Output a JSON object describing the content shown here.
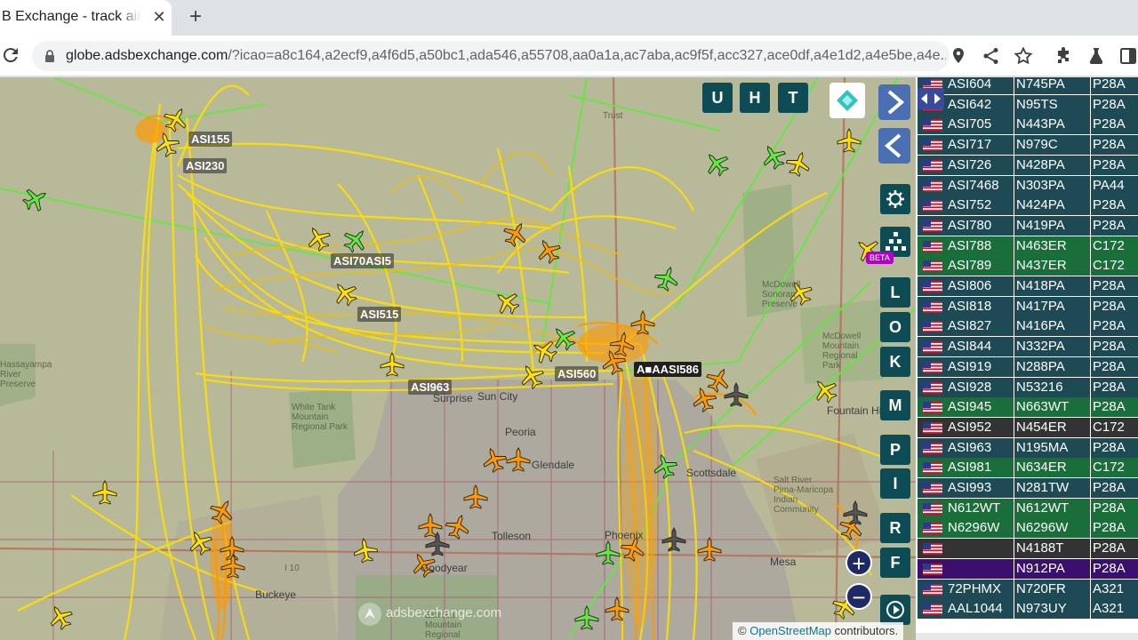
{
  "browser": {
    "tab_title": "B Exchange - track aircraft",
    "url_host": "globe.adsbexchange.com",
    "url_rest": "/?icao=a8c164,a2ecf9,a4f6d5,a50bc1,ada546,a55708,aa0a1a,ac7aba,ac9f5f,acc327,ace0df,a4e1d2,a4e5be,a4e..."
  },
  "map": {
    "callsigns": [
      "ASI155",
      "ASI230",
      "ASI70ASI5",
      "ASI515",
      "ASI963",
      "ASI560",
      "A■AASI586"
    ],
    "places": [
      "Surprise",
      "Sun City",
      "Peoria",
      "Glendale",
      "Scottsdale",
      "Tolleson",
      "Goodyear",
      "Phoenix",
      "Buckeye",
      "Mesa",
      "Fountain Hills",
      "White Tank Mountain Regional Park",
      "Trust",
      "McDowell Mountain Regional Park",
      "McDowell Sonoran Preserve",
      "Salt River Pima-Maricopa Indian Community",
      "Estrella Mountain Regional Park",
      "Hassayampa River Preserve",
      "I 10"
    ],
    "buttons": {
      "u": "U",
      "h": "H",
      "t": "T",
      "l": "L",
      "o": "O",
      "k": "K",
      "m": "M",
      "p": "P",
      "i": "I",
      "r": "R",
      "f": "F"
    },
    "beta_label": "BETA",
    "watermark": "adsbexchange.com",
    "attribution_prefix": "©",
    "attribution_link": "OpenStreetMap",
    "attribution_suffix": "contributors."
  },
  "colors": {
    "row_default": "#1d4a55",
    "row_green": "#1a6e3a",
    "row_dark": "#333333",
    "row_purple": "#3b0f6e",
    "track_yellow": "#ffe000",
    "track_orange": "#ff9a00",
    "track_green": "#62e840"
  },
  "aircraft": [
    {
      "callsign": "ASI604",
      "reg": "N745PA",
      "type": "P28A",
      "style": "default"
    },
    {
      "callsign": "ASI642",
      "reg": "N95TS",
      "type": "P28A",
      "style": "default"
    },
    {
      "callsign": "ASI705",
      "reg": "N443PA",
      "type": "P28A",
      "style": "default"
    },
    {
      "callsign": "ASI717",
      "reg": "N979C",
      "type": "P28A",
      "style": "default"
    },
    {
      "callsign": "ASI726",
      "reg": "N428PA",
      "type": "P28A",
      "style": "default"
    },
    {
      "callsign": "ASI7468",
      "reg": "N303PA",
      "type": "PA44",
      "style": "default"
    },
    {
      "callsign": "ASI752",
      "reg": "N424PA",
      "type": "P28A",
      "style": "default"
    },
    {
      "callsign": "ASI780",
      "reg": "N419PA",
      "type": "P28A",
      "style": "default"
    },
    {
      "callsign": "ASI788",
      "reg": "N463ER",
      "type": "C172",
      "style": "green"
    },
    {
      "callsign": "ASI789",
      "reg": "N437ER",
      "type": "C172",
      "style": "green"
    },
    {
      "callsign": "ASI806",
      "reg": "N418PA",
      "type": "P28A",
      "style": "default"
    },
    {
      "callsign": "ASI818",
      "reg": "N417PA",
      "type": "P28A",
      "style": "default"
    },
    {
      "callsign": "ASI827",
      "reg": "N416PA",
      "type": "P28A",
      "style": "default"
    },
    {
      "callsign": "ASI844",
      "reg": "N332PA",
      "type": "P28A",
      "style": "default"
    },
    {
      "callsign": "ASI919",
      "reg": "N288PA",
      "type": "P28A",
      "style": "default"
    },
    {
      "callsign": "ASI928",
      "reg": "N53216",
      "type": "P28A",
      "style": "default"
    },
    {
      "callsign": "ASI945",
      "reg": "N663WT",
      "type": "P28A",
      "style": "green"
    },
    {
      "callsign": "ASI952",
      "reg": "N454ER",
      "type": "C172",
      "style": "dark"
    },
    {
      "callsign": "ASI963",
      "reg": "N195MA",
      "type": "P28A",
      "style": "default"
    },
    {
      "callsign": "ASI981",
      "reg": "N634ER",
      "type": "C172",
      "style": "green"
    },
    {
      "callsign": "ASI993",
      "reg": "N281TW",
      "type": "P28A",
      "style": "default"
    },
    {
      "callsign": "N612WT",
      "reg": "N612WT",
      "type": "P28A",
      "style": "green"
    },
    {
      "callsign": "N6296W",
      "reg": "N6296W",
      "type": "P28A",
      "style": "green"
    },
    {
      "callsign": "",
      "reg": "N4188T",
      "type": "P28A",
      "style": "dark"
    },
    {
      "callsign": "",
      "reg": "N912PA",
      "type": "P28A",
      "style": "purple"
    },
    {
      "callsign": "72PHMX",
      "reg": "N720FR",
      "type": "A321",
      "style": "default"
    },
    {
      "callsign": "AAL1044",
      "reg": "N973UY",
      "type": "A321",
      "style": "default"
    }
  ]
}
